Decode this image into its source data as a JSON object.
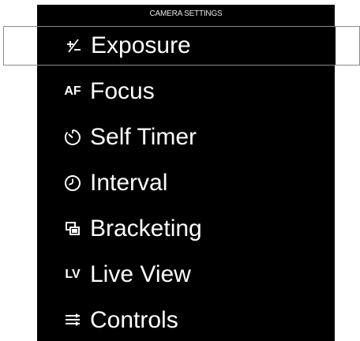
{
  "header": {
    "title": "CAMERA SETTINGS"
  },
  "menu": {
    "items": [
      {
        "id": "exposure",
        "icon": "plus-minus-icon",
        "icon_text": "",
        "label": "Exposure",
        "selected": true
      },
      {
        "id": "focus",
        "icon": "af-icon",
        "icon_text": "AF",
        "label": "Focus",
        "selected": false
      },
      {
        "id": "self-timer",
        "icon": "timer-icon",
        "icon_text": "",
        "label": "Self Timer",
        "selected": false
      },
      {
        "id": "interval",
        "icon": "clock-icon",
        "icon_text": "",
        "label": "Interval",
        "selected": false
      },
      {
        "id": "bracketing",
        "icon": "stacked-frames-icon",
        "icon_text": "",
        "label": "Bracketing",
        "selected": false
      },
      {
        "id": "live-view",
        "icon": "lv-icon",
        "icon_text": "LV",
        "label": "Live View",
        "selected": false
      },
      {
        "id": "controls",
        "icon": "menu-lines-icon",
        "icon_text": "",
        "label": "Controls",
        "selected": false
      }
    ]
  },
  "colors": {
    "background": "#000000",
    "text": "#ffffff",
    "selection_border": "#8a8a8a"
  }
}
